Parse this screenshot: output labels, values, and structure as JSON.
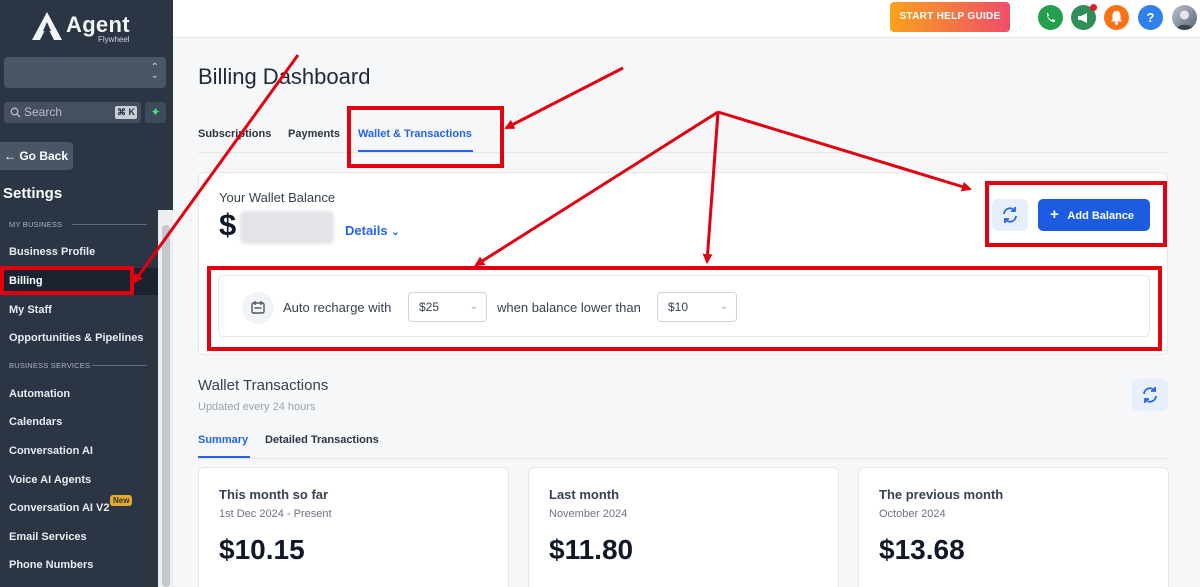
{
  "sidebar": {
    "logo_text": "Agent",
    "logo_subtitle": "Flywheel",
    "search_placeholder": "Search",
    "search_shortcut": "⌘ K",
    "go_back_label": "← Go Back",
    "settings_title": "Settings",
    "section_my_business": "MY BUSINESS",
    "section_business_services": "BUSINESS SERVICES",
    "items": [
      {
        "label": "Business Profile"
      },
      {
        "label": "Billing"
      },
      {
        "label": "My Staff"
      },
      {
        "label": "Opportunities & Pipelines"
      },
      {
        "label": "Automation"
      },
      {
        "label": "Calendars"
      },
      {
        "label": "Conversation AI"
      },
      {
        "label": "Voice AI Agents"
      },
      {
        "label": "Conversation AI V2"
      },
      {
        "label": "Email Services"
      },
      {
        "label": "Phone Numbers"
      }
    ],
    "new_badge": "New"
  },
  "topbar": {
    "help_button": "START HELP GUIDE",
    "help_icon_label": "?",
    "icons": [
      "phone-icon",
      "megaphone-icon",
      "bell-icon",
      "help-icon",
      "user-avatar"
    ]
  },
  "main": {
    "page_title": "Billing Dashboard",
    "tabs": [
      "Subscriptions",
      "Payments",
      "Wallet & Transactions"
    ],
    "wallet": {
      "label": "Your Wallet Balance",
      "currency_symbol": "$",
      "details_link": "Details",
      "add_balance_button": "Add Balance"
    },
    "recharge": {
      "text_prefix": "Auto recharge with",
      "amount_value": "$25",
      "text_middle": "when balance lower than",
      "threshold_value": "$10"
    },
    "transactions": {
      "title": "Wallet Transactions",
      "subtitle": "Updated every 24 hours",
      "tabs": [
        "Summary",
        "Detailed Transactions"
      ],
      "cards": [
        {
          "title": "This month so far",
          "range": "1st Dec 2024 - Present",
          "amount": "$10.15"
        },
        {
          "title": "Last month",
          "range": "November 2024",
          "amount": "$11.80"
        },
        {
          "title": "The previous month",
          "range": "October 2024",
          "amount": "$13.68"
        }
      ]
    }
  },
  "colors": {
    "accent": "#2563eb",
    "sidebar_bg": "#2b3544",
    "annotation_red": "#e3000f"
  }
}
